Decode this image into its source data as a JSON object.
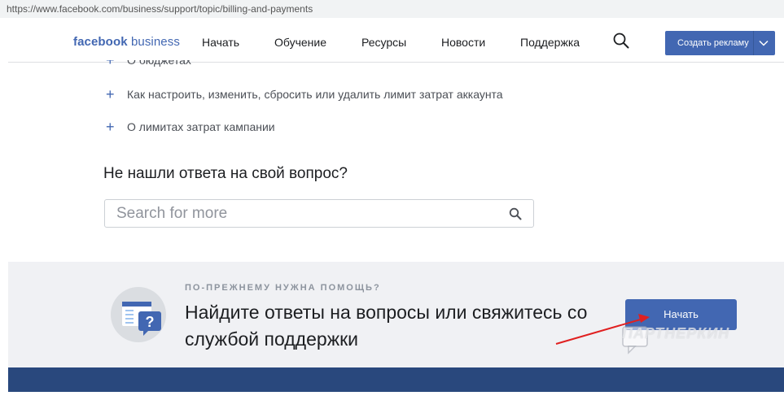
{
  "browser": {
    "url": "https://www.facebook.com/business/support/topic/billing-and-payments"
  },
  "header": {
    "logo_bold": "facebook",
    "logo_light": "business",
    "nav": [
      "Начать",
      "Обучение",
      "Ресурсы",
      "Новости",
      "Поддержка"
    ],
    "search_icon": "search-icon",
    "cta_label": "Создать рекламу",
    "cta_caret_icon": "chevron-down-icon"
  },
  "faq": {
    "partial_item": "О бюджетах",
    "items": [
      "Как настроить, изменить, сбросить или удалить лимит затрат аккаунта",
      "О лимитах затрат кампании"
    ]
  },
  "search_section": {
    "title": "Не нашли ответа на свой вопрос?",
    "placeholder": "Search for more"
  },
  "help": {
    "kicker": "ПО-ПРЕЖНЕМУ НУЖНА ПОМОЩЬ?",
    "text": "Найдите ответы на вопросы или свяжитесь со службой поддержки",
    "button": "Начать"
  },
  "watermark": {
    "text": "ПАРТНЕРКИН"
  },
  "colors": {
    "brand": "#4267b2",
    "footer": "#29487d",
    "help_bg": "#f0f1f4",
    "arrow": "#e02020"
  }
}
